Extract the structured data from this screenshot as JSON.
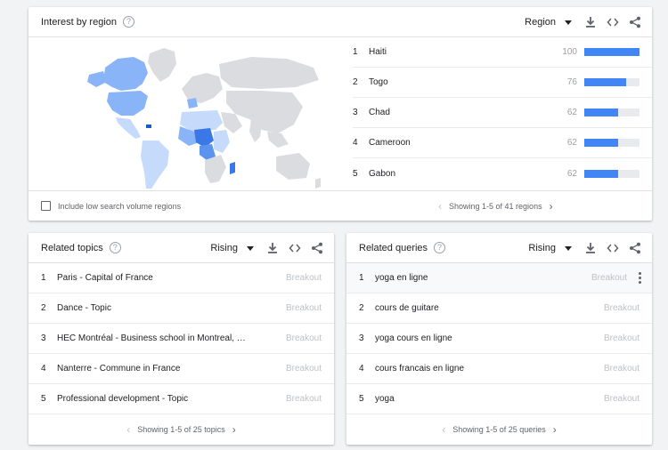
{
  "region_card": {
    "title": "Interest by region",
    "selector": "Region",
    "checkbox_label": "Include low search volume regions",
    "pager_text": "Showing 1-5 of 41 regions",
    "rows": [
      {
        "rank": "1",
        "name": "Haiti",
        "value": "100",
        "fraction": 1.0
      },
      {
        "rank": "2",
        "name": "Togo",
        "value": "76",
        "fraction": 0.76
      },
      {
        "rank": "3",
        "name": "Chad",
        "value": "62",
        "fraction": 0.62
      },
      {
        "rank": "4",
        "name": "Cameroon",
        "value": "62",
        "fraction": 0.62
      },
      {
        "rank": "5",
        "name": "Gabon",
        "value": "62",
        "fraction": 0.62
      }
    ]
  },
  "topics_card": {
    "title": "Related topics",
    "selector": "Rising",
    "pager_text": "Showing 1-5 of 25 topics",
    "rows": [
      {
        "rank": "1",
        "text": "Paris - Capital of France",
        "value": "Breakout"
      },
      {
        "rank": "2",
        "text": "Dance - Topic",
        "value": "Breakout"
      },
      {
        "rank": "3",
        "text": "HEC Montréal - Business school in Montreal, Q...",
        "value": "Breakout"
      },
      {
        "rank": "4",
        "text": "Nanterre - Commune in France",
        "value": "Breakout"
      },
      {
        "rank": "5",
        "text": "Professional development - Topic",
        "value": "Breakout"
      }
    ]
  },
  "queries_card": {
    "title": "Related queries",
    "selector": "Rising",
    "pager_text": "Showing 1-5 of 25 queries",
    "rows": [
      {
        "rank": "1",
        "text": "yoga en ligne",
        "value": "Breakout"
      },
      {
        "rank": "2",
        "text": "cours de guitare",
        "value": "Breakout"
      },
      {
        "rank": "3",
        "text": "yoga cours en ligne",
        "value": "Breakout"
      },
      {
        "rank": "4",
        "text": "cours francais en ligne",
        "value": "Breakout"
      },
      {
        "rank": "5",
        "text": "yoga",
        "value": "Breakout"
      }
    ]
  },
  "colors": {
    "bar": "#4285f4",
    "map_high": "#3b78e7",
    "map_mid": "#8ab4f8",
    "map_low": "#c6dafc",
    "map_none": "#dadce0"
  },
  "icons": {
    "help": "help-circle-icon",
    "download": "download-icon",
    "embed": "embed-code-icon",
    "share": "share-icon",
    "prev": "chevron-left-icon",
    "next": "chevron-right-icon",
    "more": "more-vert-icon"
  }
}
